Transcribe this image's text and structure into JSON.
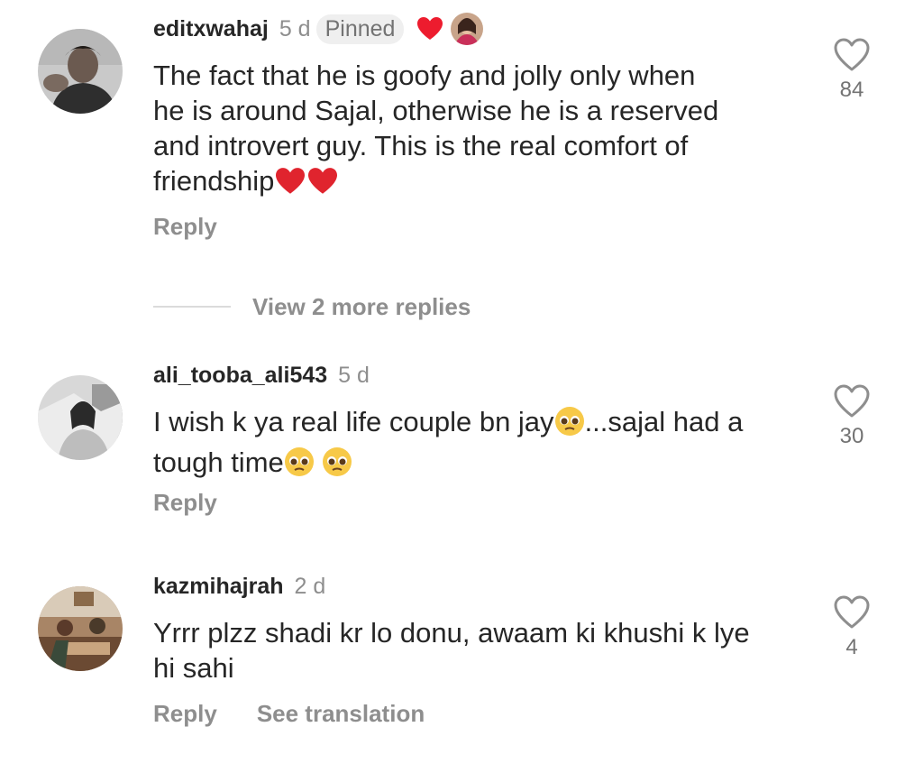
{
  "comments": [
    {
      "username": "editxwahaj",
      "time": "5 d",
      "pinned_label": "Pinned",
      "text_lines": [
        "The fact that he is goofy and jolly only when",
        "he is around Sajal, otherwise he is a reserved",
        "and introvert guy. This is the real comfort of",
        "friendship"
      ],
      "likes": "84",
      "reply_label": "Reply"
    },
    {
      "username": "ali_tooba_ali543",
      "time": "5 d",
      "text_line1_a": "I wish k ya real life couple bn jay",
      "text_line1_b": "...sajal had a",
      "text_line2": "tough time",
      "likes": "30",
      "reply_label": "Reply"
    },
    {
      "username": "kazmihajrah",
      "time": "2 d",
      "text_lines": [
        "Yrrr plzz shadi kr lo donu, awaam ki khushi k lye",
        "hi sahi"
      ],
      "likes": "4",
      "reply_label": "Reply",
      "translation_label": "See translation"
    }
  ],
  "view_replies": "View 2 more replies",
  "colors": {
    "text": "#262626",
    "secondary": "#8e8e8e",
    "heart_red": "#ed4956"
  },
  "icons": [
    "heart-outline-icon",
    "red-heart-emoji",
    "pleading-face-emoji"
  ]
}
